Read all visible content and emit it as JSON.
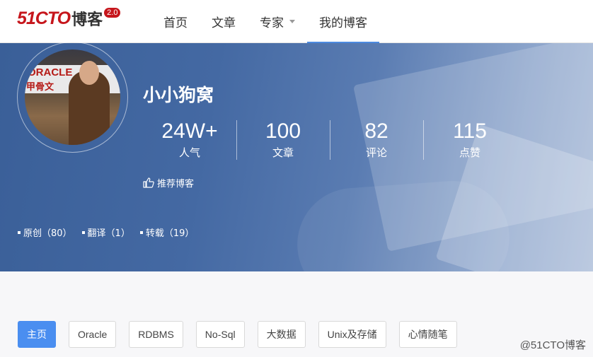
{
  "header": {
    "logo": {
      "main": "51CTO",
      "cn": "博客",
      "version": "2.0"
    },
    "nav": [
      {
        "label": "首页",
        "active": false,
        "has_dropdown": false
      },
      {
        "label": "文章",
        "active": false,
        "has_dropdown": false
      },
      {
        "label": "专家",
        "active": false,
        "has_dropdown": true
      },
      {
        "label": "我的博客",
        "active": true,
        "has_dropdown": false
      }
    ],
    "accent_color": "#4c8ae0"
  },
  "profile": {
    "blog_name": "小小狗窝",
    "avatar": {
      "sign_line1": "ORACLE",
      "sign_line2": "甲骨文"
    },
    "stats": [
      {
        "value": "24W+",
        "label": "人气"
      },
      {
        "value": "100",
        "label": "文章"
      },
      {
        "value": "82",
        "label": "评论"
      },
      {
        "value": "115",
        "label": "点赞"
      }
    ],
    "recommend_label": "推荐博客",
    "recommend_icon": "thumbs-up-icon",
    "post_types": [
      {
        "label": "原创（80）"
      },
      {
        "label": "翻译（1）"
      },
      {
        "label": "转载（19）"
      }
    ]
  },
  "categories": [
    {
      "label": "主页",
      "active": true
    },
    {
      "label": "Oracle",
      "active": false
    },
    {
      "label": "RDBMS",
      "active": false
    },
    {
      "label": "No-Sql",
      "active": false
    },
    {
      "label": "大数据",
      "active": false
    },
    {
      "label": "Unix及存储",
      "active": false
    },
    {
      "label": "心情随笔",
      "active": false
    }
  ],
  "watermark": "@51CTO博客",
  "colors": {
    "banner": "#4469a3",
    "active_tab": "#4a8ef0",
    "logo_red": "#c6161c"
  }
}
